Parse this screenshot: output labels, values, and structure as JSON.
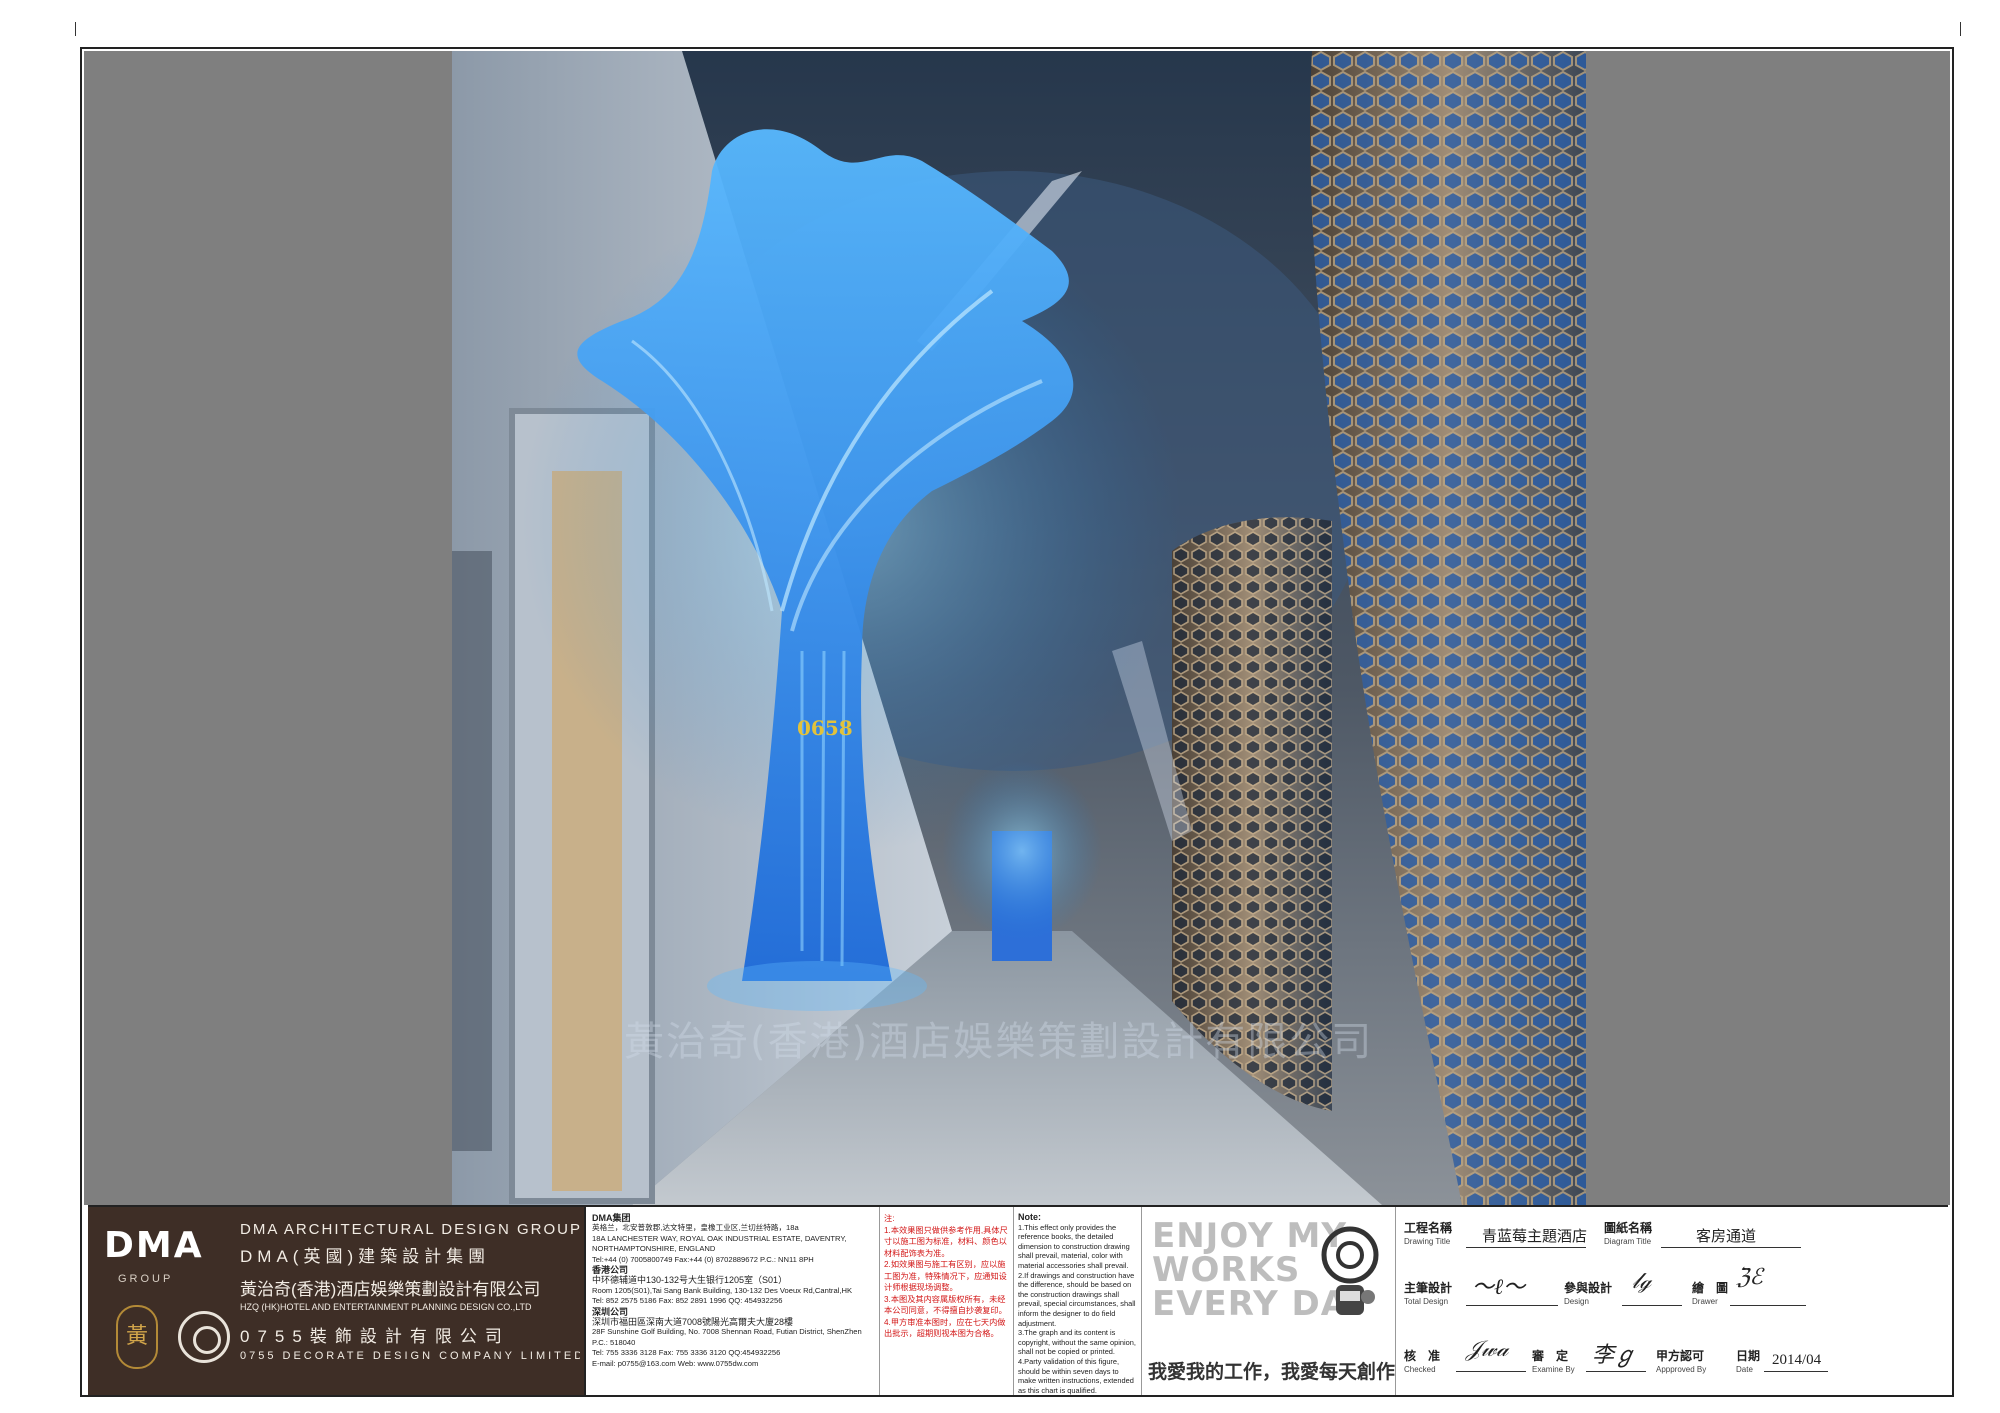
{
  "watermark": "黃治奇(香港)酒店娛樂策劃設計有限公司",
  "render": {
    "door_number": "0658"
  },
  "brand": {
    "logo": "DMA",
    "logo_sub": "GROUP",
    "seal_char": "黃",
    "line_en": "DMA ARCHITECTURAL DESIGN GROUP",
    "line_cn": "DMA(英國)建築設計集團",
    "company_cn": "黃治奇(香港)酒店娛樂策劃設計有限公司",
    "company_en": "HZQ (HK)HOTEL AND ENTERTAINMENT PLANNING DESIGN CO.,LTD",
    "decor_cn": "0755裝飾設計有限公司",
    "decor_en": "0755 DECORATE DESIGN COMPANY LIMITED"
  },
  "addresses": {
    "group_title": "DMA集团",
    "group_cn": "英格兰，北安普敦郡,达文特里，皇橡工业区,兰切丝特路，18a",
    "group_en": "18A LANCHESTER WAY, ROYAL OAK INDUSTRIAL ESTATE, DAVENTRY, NORTHAMPTONSHIRE, ENGLAND",
    "group_tel": "Tel:+44 (0) 7005800749    Fax:+44 (0) 8702889672    P.C.: NN11 8PH",
    "hk_title": "香港公司",
    "hk_cn": "中环德辅道中130-132号大生银行1205室（S01）",
    "hk_en": "Room 1205(S01),Tai Sang Bank Building, 130-132 Des Voeux Rd,Cantral,HK",
    "hk_tel": "Tel: 852 2575 5186    Fax: 852 2891 1996    QQ: 454932256",
    "sz_title": "深圳公司",
    "sz_cn": "深圳市福田區深南大道7008號陽光高爾夫大廈28樓",
    "sz_en": "28F Sunshine Golf Building, No. 7008 Shennan Road, Futian District, ShenZhen   P.C.: 518040",
    "sz_tel": "Tel: 755 3336 3128    Fax: 755 3336 3120    QQ:454932256",
    "email": "E-mail: p0755@163.com                Web: www.0755dw.com"
  },
  "notes_cn": {
    "title": "注:",
    "lines": [
      "1.本效果图只做供参考作用,具体尺寸以施工图为标准，材料、颜色以材料配饰表为准。",
      "2.如效果图与施工有区别，应以施工图为准，特殊情况下，应通知设计师根据现场调整。",
      "3.本图及其内容属版权所有，未经本公司同意，不得擅自抄袭复印。",
      "4.甲方审准本图时，应在七天内做出批示，超期则视本图为合格。"
    ]
  },
  "notes_en": {
    "title": "Note:",
    "lines": [
      "1.This effect only provides the reference books, the detailed dimension to construction drawing shall prevail, material, color with material accessories shall prevail.",
      "2.If drawings and construction have the difference, should be based on the construction drawings shall prevail, special circumstances, shall inform the designer to do field adjustment.",
      "3.The graph and its content is copyright, without the same opinion, shall not be copied or printed.",
      "4.Party validation of this figure, should be within seven days to make written instructions, extended as this chart is qualified."
    ]
  },
  "slogan": {
    "line1": "ENJOY MY",
    "line2": "WORKS",
    "line3": "EVERY DAY",
    "motto": "我愛我的工作，我愛每天創作"
  },
  "fields": {
    "project_label": "工程名稱",
    "project_en": "Drawing Title",
    "project_value": "青蓝莓主題酒店",
    "diagram_label": "圖紙名稱",
    "diagram_en": "Diagram Title",
    "diagram_value": "客房通道",
    "total_label": "主筆設計",
    "total_en": "Total Design",
    "design_label": "參與設計",
    "design_en": "Design",
    "drawer_label": "繪　圖",
    "drawer_en": "Drawer",
    "checked_label": "核　准",
    "checked_en": "Checked",
    "examine_label": "審　定",
    "examine_en": "Examine By",
    "approved_label": "甲方認可",
    "approved_en": "Appproved By",
    "date_label": "日期",
    "date_en": "Date",
    "date_value": "2014/04"
  }
}
